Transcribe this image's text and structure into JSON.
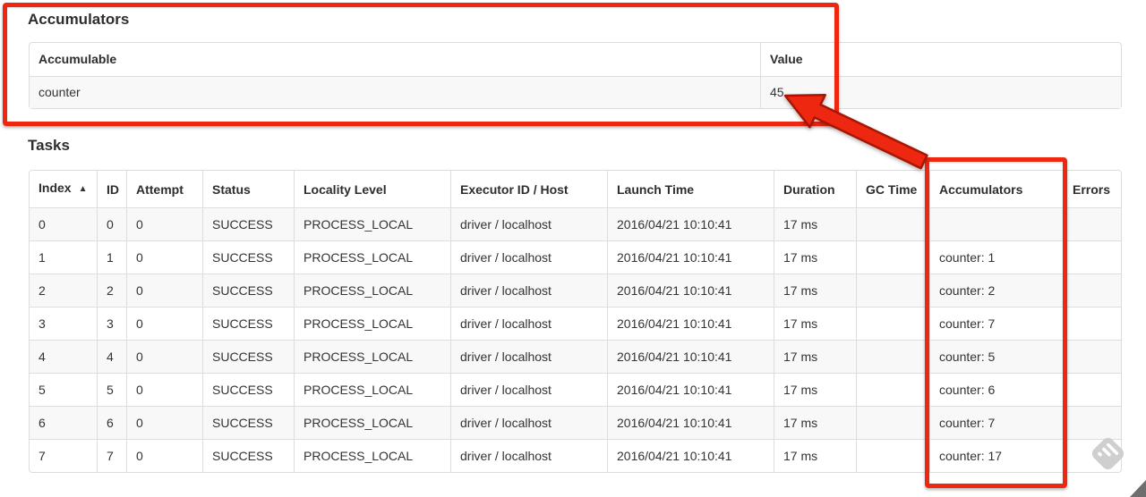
{
  "annotation": {
    "color": "#ee2711",
    "outline": "#a81503"
  },
  "theme": {
    "table_border": "#dddddd",
    "row_stripe": "#f8f8f8",
    "text": "#333333",
    "watermark_gray": "#cbcbcb"
  },
  "accumulators_section": {
    "title": "Accumulators",
    "table": {
      "headers": [
        "Accumulable",
        "Value"
      ],
      "rows": [
        {
          "accumulable": "counter",
          "value": "45"
        }
      ]
    }
  },
  "tasks_section": {
    "title": "Tasks",
    "table": {
      "headers": [
        "Index",
        "ID",
        "Attempt",
        "Status",
        "Locality Level",
        "Executor ID / Host",
        "Launch Time",
        "Duration",
        "GC Time",
        "Accumulators",
        "Errors"
      ],
      "sort_icon": "▲",
      "rows": [
        {
          "index": "0",
          "id": "0",
          "attempt": "0",
          "status": "SUCCESS",
          "locality_level": "PROCESS_LOCAL",
          "executor_id_host": "driver / localhost",
          "launch_time": "2016/04/21 10:10:41",
          "duration": "17 ms",
          "gc_time": "",
          "accumulators": "",
          "errors": ""
        },
        {
          "index": "1",
          "id": "1",
          "attempt": "0",
          "status": "SUCCESS",
          "locality_level": "PROCESS_LOCAL",
          "executor_id_host": "driver / localhost",
          "launch_time": "2016/04/21 10:10:41",
          "duration": "17 ms",
          "gc_time": "",
          "accumulators": "counter: 1",
          "errors": ""
        },
        {
          "index": "2",
          "id": "2",
          "attempt": "0",
          "status": "SUCCESS",
          "locality_level": "PROCESS_LOCAL",
          "executor_id_host": "driver / localhost",
          "launch_time": "2016/04/21 10:10:41",
          "duration": "17 ms",
          "gc_time": "",
          "accumulators": "counter: 2",
          "errors": ""
        },
        {
          "index": "3",
          "id": "3",
          "attempt": "0",
          "status": "SUCCESS",
          "locality_level": "PROCESS_LOCAL",
          "executor_id_host": "driver / localhost",
          "launch_time": "2016/04/21 10:10:41",
          "duration": "17 ms",
          "gc_time": "",
          "accumulators": "counter: 7",
          "errors": ""
        },
        {
          "index": "4",
          "id": "4",
          "attempt": "0",
          "status": "SUCCESS",
          "locality_level": "PROCESS_LOCAL",
          "executor_id_host": "driver / localhost",
          "launch_time": "2016/04/21 10:10:41",
          "duration": "17 ms",
          "gc_time": "",
          "accumulators": "counter: 5",
          "errors": ""
        },
        {
          "index": "5",
          "id": "5",
          "attempt": "0",
          "status": "SUCCESS",
          "locality_level": "PROCESS_LOCAL",
          "executor_id_host": "driver / localhost",
          "launch_time": "2016/04/21 10:10:41",
          "duration": "17 ms",
          "gc_time": "",
          "accumulators": "counter: 6",
          "errors": ""
        },
        {
          "index": "6",
          "id": "6",
          "attempt": "0",
          "status": "SUCCESS",
          "locality_level": "PROCESS_LOCAL",
          "executor_id_host": "driver / localhost",
          "launch_time": "2016/04/21 10:10:41",
          "duration": "17 ms",
          "gc_time": "",
          "accumulators": "counter: 7",
          "errors": ""
        },
        {
          "index": "7",
          "id": "7",
          "attempt": "0",
          "status": "SUCCESS",
          "locality_level": "PROCESS_LOCAL",
          "executor_id_host": "driver / localhost",
          "launch_time": "2016/04/21 10:10:41",
          "duration": "17 ms",
          "gc_time": "",
          "accumulators": "counter: 17",
          "errors": ""
        }
      ]
    }
  }
}
